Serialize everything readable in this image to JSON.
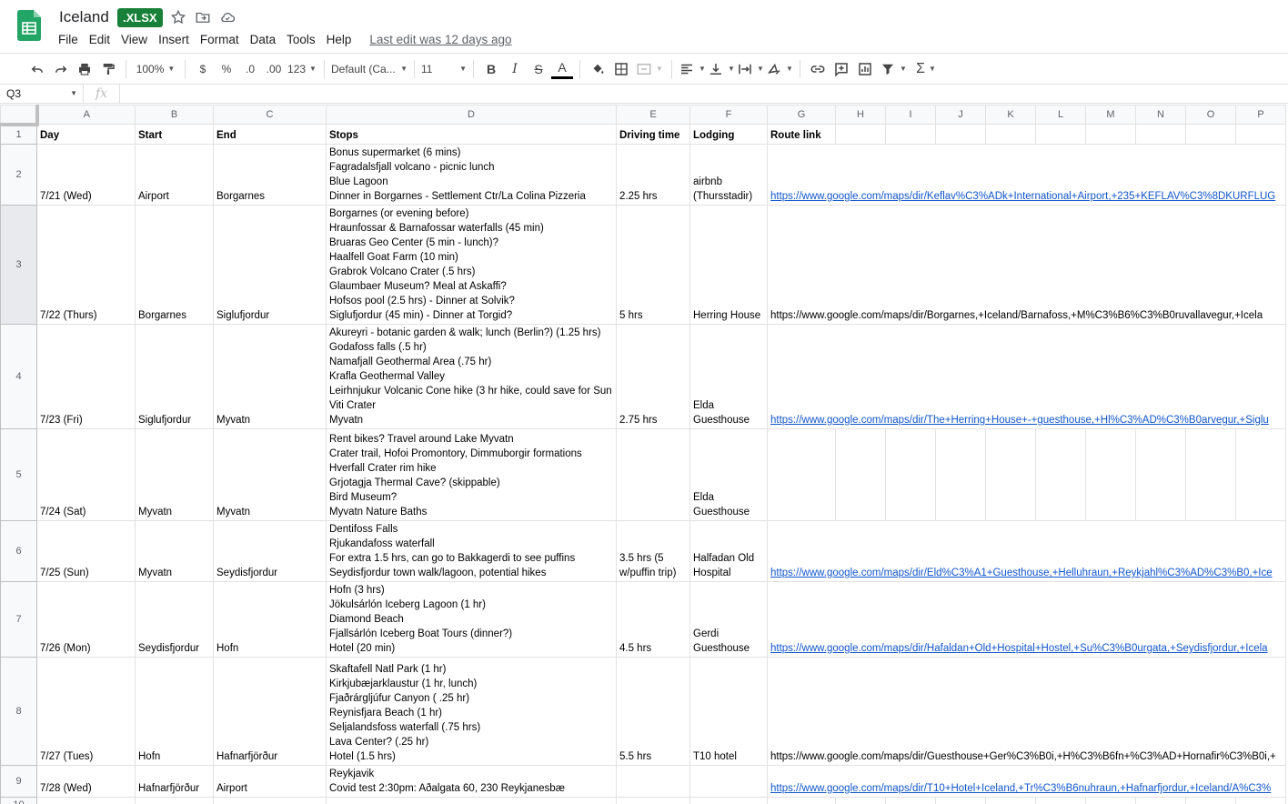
{
  "app": {
    "title": "Iceland",
    "badge": ".XLSX",
    "menu": [
      "File",
      "Edit",
      "View",
      "Insert",
      "Format",
      "Data",
      "Tools",
      "Help"
    ],
    "last_edit": "Last edit was 12 days ago"
  },
  "toolbar": {
    "zoom": "100%",
    "currency": "$",
    "percent": "%",
    "dec_decrease": ".0",
    "dec_increase": ".00",
    "format_more": "123",
    "font": "Default (Ca...",
    "font_size": "11",
    "bold": "B",
    "italic": "I",
    "strike": "S",
    "text_color": "A",
    "function": "Σ"
  },
  "formula_bar": {
    "cell_ref": "Q3",
    "fx": "fx",
    "content": ""
  },
  "columns": [
    "A",
    "B",
    "C",
    "D",
    "E",
    "F",
    "G",
    "H",
    "I",
    "J",
    "K",
    "L",
    "M",
    "N",
    "O",
    "P"
  ],
  "header_row": {
    "num": "1",
    "cells": [
      "Day",
      "Start",
      "End",
      "Stops",
      "Driving time",
      "Lodging",
      "Route link"
    ]
  },
  "rows": [
    {
      "num": "2",
      "day": "7/21 (Wed)",
      "start": "Airport",
      "end": "Borgarnes",
      "stops": [
        "Bonus supermarket (6 mins)",
        "Fagradalsfjall volcano - picnic lunch",
        "Blue Lagoon",
        "Dinner in Borgarnes - Settlement Ctr/La Colina Pizzeria"
      ],
      "driving": "2.25 hrs",
      "lodging": [
        "airbnb",
        "(Thursstadir)"
      ],
      "route": "https://www.google.com/maps/dir/Keflav%C3%ADk+International+Airport,+235+KEFLAV%C3%8DKURFLUG",
      "route_is_link": true
    },
    {
      "num": "3",
      "day": "7/22 (Thurs)",
      "start": "Borgarnes",
      "end": "Siglufjordur",
      "stops": [
        "Borgarnes (or evening before)",
        "Hraunfossar & Barnafossar waterfalls (45 min)",
        "Bruaras Geo Center (5  min - lunch)?",
        "Haalfell Goat Farm (10 min)",
        "Grabrok Volcano Crater (.5 hrs)",
        "Glaumbaer Museum? Meal at Askaffi?",
        "Hofsos pool (2.5 hrs) - Dinner at Solvik?",
        "Siglufjordur (45 min) - Dinner at Torgid?"
      ],
      "driving": "5 hrs",
      "lodging": [
        "Herring House"
      ],
      "route": "https://www.google.com/maps/dir/Borgarnes,+Iceland/Barnafoss,+M%C3%B6%C3%B0ruvallavegur,+Icela",
      "route_is_link": false
    },
    {
      "num": "4",
      "day": "7/23 (Fri)",
      "start": "Siglufjordur",
      "end": "Myvatn",
      "stops": [
        "Akureyri - botanic garden & walk; lunch (Berlin?) (1.25 hrs)",
        "Godafoss falls (.5 hr)",
        "Namafjall Geothermal Area (.75 hr)",
        "Krafla Geothermal Valley",
        "Leirhnjukur Volcanic Cone hike (3 hr hike, could save for Sun",
        "Viti Crater",
        "Myvatn"
      ],
      "driving": "2.75 hrs",
      "lodging": [
        "Elda",
        "Guesthouse"
      ],
      "route": "https://www.google.com/maps/dir/The+Herring+House+-+guesthouse,+Hl%C3%AD%C3%B0arvegur,+Siglu",
      "route_is_link": true
    },
    {
      "num": "5",
      "day": "7/24 (Sat)",
      "start": "Myvatn",
      "end": "Myvatn",
      "stops": [
        "Rent bikes?  Travel around Lake Myvatn",
        "Crater trail, Hofoi Promontory, Dimmuborgir formations",
        "Hverfall Crater rim hike",
        "Grjotagja Thermal Cave? (skippable)",
        "Bird Museum?",
        "Myvatn Nature Baths"
      ],
      "driving": "",
      "lodging": [
        "Elda",
        "Guesthouse"
      ],
      "route": "",
      "route_is_link": false
    },
    {
      "num": "6",
      "day": "7/25 (Sun)",
      "start": "Myvatn",
      "end": "Seydisfjordur",
      "stops": [
        "Dentifoss Falls",
        "Rjukandafoss waterfall",
        "For extra 1.5 hrs, can go to Bakkagerdi to see puffins",
        "Seydisfjordur town walk/lagoon, potential hikes"
      ],
      "driving": "3.5 hrs (5\nw/puffin trip)",
      "driving_lines": [
        "3.5 hrs (5",
        "w/puffin trip)"
      ],
      "lodging": [
        "Halfadan Old",
        "Hospital"
      ],
      "route": "https://www.google.com/maps/dir/Eld%C3%A1+Guesthouse,+Helluhraun,+Reykjahl%C3%AD%C3%B0,+Ice",
      "route_is_link": true
    },
    {
      "num": "7",
      "day": "7/26 (Mon)",
      "start": "Seydisfjordur",
      "end": "Hofn",
      "stops": [
        "Hofn (3 hrs)",
        "Jökulsárlón Iceberg Lagoon (1 hr)",
        "Diamond Beach",
        "Fjallsárlón Iceberg Boat Tours (dinner?)",
        "Hotel (20 min)"
      ],
      "driving": "4.5 hrs",
      "lodging": [
        "Gerdi",
        "Guesthouse"
      ],
      "route": "https://www.google.com/maps/dir/Hafaldan+Old+Hospital+Hostel,+Su%C3%B0urgata,+Seydisfjordur,+Icela",
      "route_is_link": true
    },
    {
      "num": "8",
      "day": "7/27 (Tues)",
      "start": "Hofn",
      "end": "Hafnarfjörður",
      "stops": [
        "Skaftafell Natl Park (1 hr)",
        "Kirkjubæjarklaustur (1 hr, lunch)",
        "Fjaðrárgljúfur Canyon ( .25 hr)",
        "Reynisfjara Beach (1 hr)",
        "Seljalandsfoss waterfall (.75 hrs)",
        "Lava Center? (.25 hr)",
        "Hotel (1.5 hrs)"
      ],
      "driving": "5.5 hrs",
      "lodging": [
        "T10 hotel"
      ],
      "route": "https://www.google.com/maps/dir/Guesthouse+Ger%C3%B0i,+H%C3%B6fn+%C3%AD+Hornafir%C3%B0i,+",
      "route_is_link": false
    },
    {
      "num": "9",
      "day": "7/28 (Wed)",
      "start": "Hafnarfjörður",
      "end": "Airport",
      "stops": [
        "Reykjavik",
        "Covid test 2:30pm: Aðalgata 60, 230 Reykjanesbæ"
      ],
      "driving": "",
      "lodging": [],
      "route": "https://www.google.com/maps/dir/T10+Hotel+Iceland,+Tr%C3%B6nuhraun,+Hafnarfjordur,+Iceland/A%C3%",
      "route_is_link": true
    }
  ],
  "empty_row": {
    "num": "10"
  },
  "colors": {
    "accent": "#1a73e8",
    "link": "#1155cc",
    "badge": "#188038",
    "logo": "#0f9d58"
  }
}
